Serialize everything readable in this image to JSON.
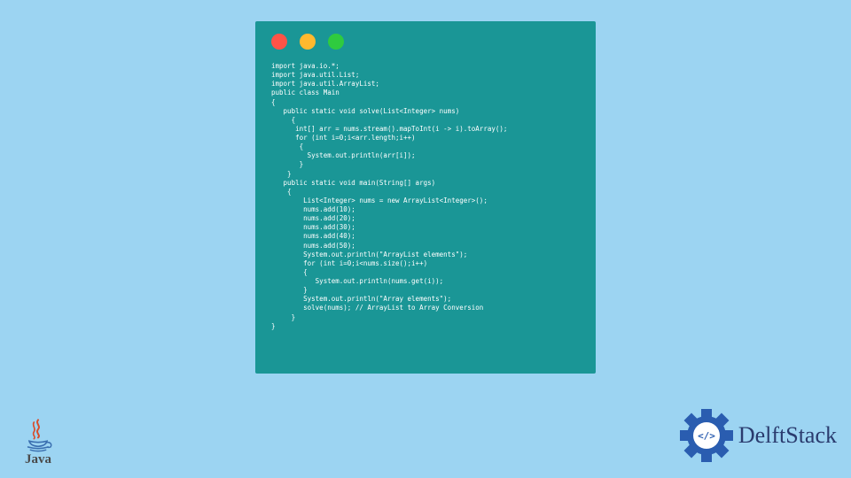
{
  "code": {
    "lines": [
      "import java.io.*;",
      "import java.util.List;",
      "import java.util.ArrayList;",
      "public class Main",
      "{",
      "   public static void solve(List<Integer> nums)",
      "     {",
      "      int[] arr = nums.stream().mapToInt(i -> i).toArray();",
      "      for (int i=0;i<arr.length;i++)",
      "       {",
      "         System.out.println(arr[i]);",
      "       }",
      "    }",
      "   public static void main(String[] args)",
      "    {",
      "        List<Integer> nums = new ArrayList<Integer>();",
      "        nums.add(10);",
      "        nums.add(20);",
      "        nums.add(30);",
      "        nums.add(40);",
      "        nums.add(50);",
      "        System.out.println(\"ArrayList elements\");",
      "        for (int i=0;i<nums.size();i++)",
      "        {",
      "           System.out.println(nums.get(i));",
      "        }",
      "        System.out.println(\"Array elements\");",
      "        solve(nums); // ArrayList to Array Conversion",
      "     }",
      "}"
    ]
  },
  "branding": {
    "java_label": "Java",
    "delftstack_label": "DelftStack"
  },
  "colors": {
    "background": "#9cd4f2",
    "window": "#1a9696",
    "traffic_red": "#ff5347",
    "traffic_yellow": "#ffb92e",
    "traffic_green": "#2fcb3f",
    "delft_blue": "#2a3b6e"
  }
}
